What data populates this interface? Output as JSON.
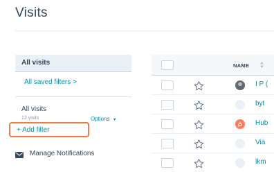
{
  "page": {
    "title": "Visits"
  },
  "sidebar": {
    "active_filter": "All visits",
    "saved_filters_link": "All saved filters >",
    "current_view": {
      "title": "All visits",
      "count": "12 visits",
      "options_label": "Options"
    },
    "add_filter_label": "+ Add filter",
    "manage_notifications_label": "Manage Notifications"
  },
  "table": {
    "columns": [
      "NAME"
    ],
    "rows": [
      {
        "name": "I P (",
        "avatar": "photo",
        "starred": false
      },
      {
        "name": "byt",
        "avatar": "gray",
        "starred": false
      },
      {
        "name": "Hub",
        "avatar": "hubspot",
        "starred": false
      },
      {
        "name": "Via",
        "avatar": "gray",
        "starred": false
      },
      {
        "name": "lkm",
        "avatar": "gray",
        "starred": false
      }
    ]
  },
  "colors": {
    "accent_link": "#0091ae",
    "highlight_border": "#e87e4d",
    "hubspot_orange": "#ff7a59",
    "text": "#33475b"
  },
  "icons": [
    "checkbox",
    "star-icon",
    "sort-icon",
    "envelope-icon",
    "caret-down-icon",
    "hubspot-sprocket-icon"
  ]
}
